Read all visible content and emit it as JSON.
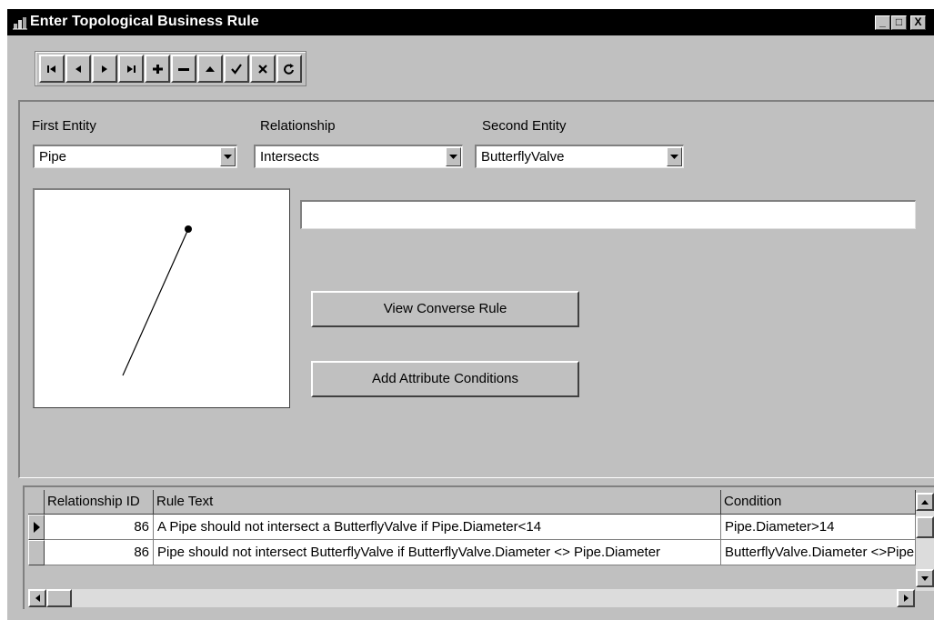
{
  "window": {
    "title": "Enter Topological Business Rule",
    "controls": {
      "minimize": "_",
      "maximize": "□",
      "close": "X"
    }
  },
  "toolbar": {
    "buttons": [
      {
        "name": "first-record",
        "icon": "first-record-icon"
      },
      {
        "name": "previous-record",
        "icon": "previous-record-icon"
      },
      {
        "name": "next-record",
        "icon": "next-record-icon"
      },
      {
        "name": "last-record",
        "icon": "last-record-icon"
      },
      {
        "name": "add-record",
        "icon": "plus-icon"
      },
      {
        "name": "delete-record",
        "icon": "minus-icon"
      },
      {
        "name": "edit-record",
        "icon": "up-triangle-icon"
      },
      {
        "name": "post-edit",
        "icon": "checkmark-icon"
      },
      {
        "name": "cancel-edit",
        "icon": "x-icon"
      },
      {
        "name": "refresh",
        "icon": "refresh-icon"
      }
    ]
  },
  "form": {
    "first_entity": {
      "label": "First Entity",
      "value": "Pipe"
    },
    "relationship": {
      "label": "Relationship",
      "value": "Intersects"
    },
    "second_entity": {
      "label": "Second Entity",
      "value": "ButterflyValve"
    },
    "rule_text_input": "",
    "view_converse_button": "View Converse Rule",
    "add_conditions_button": "Add Attribute Conditions"
  },
  "grid": {
    "columns": [
      "Relationship ID",
      "Rule Text",
      "Condition"
    ],
    "rows": [
      {
        "id": "86",
        "rule_text": "A Pipe should not intersect a ButterflyValve if  Pipe.Diameter<14",
        "condition": "Pipe.Diameter>14",
        "current": true
      },
      {
        "id": "86",
        "rule_text": "Pipe should not intersect ButterflyValve if  ButterflyValve.Diameter <> Pipe.Diameter",
        "condition": "ButterflyValve.Diameter <>Pipe.Diameter",
        "current": false
      }
    ]
  },
  "colors": {
    "titlebar": "#000000",
    "face": "#c0c0c0",
    "field": "#ffffff"
  }
}
